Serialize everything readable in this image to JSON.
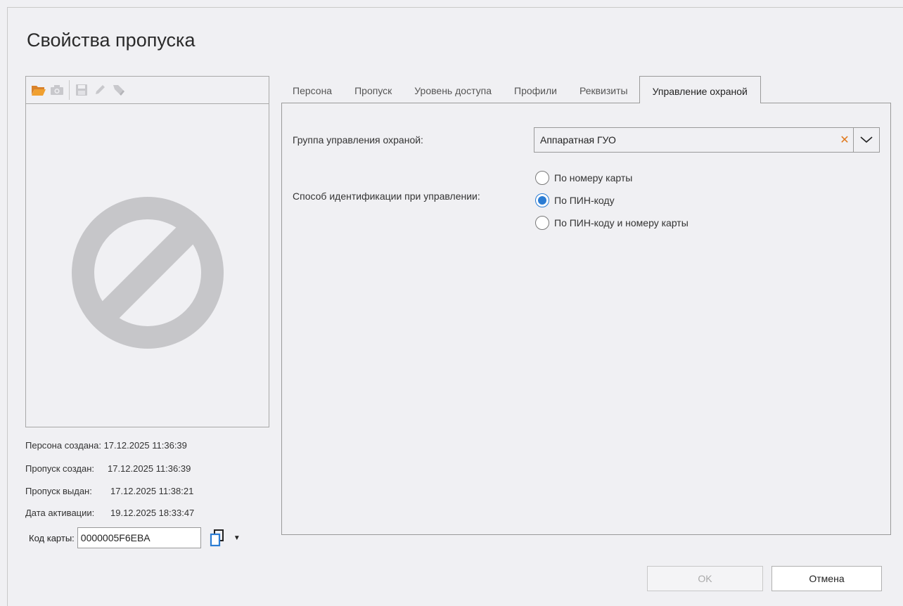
{
  "dialog": {
    "title": "Свойства пропуска"
  },
  "photo_toolbar": {
    "icons": [
      "open-folder-icon",
      "camera-icon",
      "save-icon",
      "edit-icon",
      "erase-icon"
    ]
  },
  "info": {
    "person_created": {
      "label": "Персона создана:",
      "value": "17.12.2025 11:36:39"
    },
    "pass_created": {
      "label": "Пропуск создан:",
      "value": "17.12.2025 11:36:39"
    },
    "pass_issued": {
      "label": "Пропуск выдан:",
      "value": "17.12.2025 11:38:21"
    },
    "activation_date": {
      "label": "Дата активации:",
      "value": "19.12.2025 18:33:47"
    }
  },
  "card_code": {
    "label": "Код карты:",
    "value": "0000005F6EBA"
  },
  "tabs": [
    {
      "label": "Персона"
    },
    {
      "label": "Пропуск"
    },
    {
      "label": "Уровень доступа"
    },
    {
      "label": "Профили"
    },
    {
      "label": "Реквизиты"
    },
    {
      "label": "Управление охраной"
    }
  ],
  "active_tab": "Управление охраной",
  "security": {
    "group_label": "Группа управления охраной:",
    "group_value": "Аппаратная ГУО",
    "method_label": "Способ идентификации при управлении:",
    "options": [
      {
        "label": "По номеру карты",
        "checked": false
      },
      {
        "label": "По ПИН-коду",
        "checked": true
      },
      {
        "label": "По ПИН-коду и номеру карты",
        "checked": false
      }
    ]
  },
  "buttons": {
    "ok": "OK",
    "cancel": "Отмена"
  },
  "colors": {
    "accent": "#2b7cd3",
    "clear": "#e07a1f",
    "folder": "#e8941f"
  }
}
